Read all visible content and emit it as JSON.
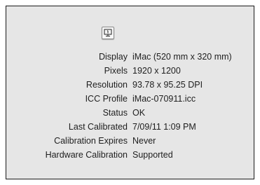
{
  "icon": "display-icon",
  "rows": [
    {
      "label": "Display",
      "value": "iMac (520 mm x 320 mm)"
    },
    {
      "label": "Pixels",
      "value": "1920 x 1200"
    },
    {
      "label": "Resolution",
      "value": "93.78 x 95.25 DPI"
    },
    {
      "label": "ICC Profile",
      "value": "iMac-070911.icc"
    },
    {
      "label": "Status",
      "value": "OK"
    },
    {
      "label": "Last Calibrated",
      "value": "7/09/11 1:09 PM"
    },
    {
      "label": "Calibration Expires",
      "value": "Never"
    },
    {
      "label": "Hardware Calibration",
      "value": "Supported"
    }
  ]
}
